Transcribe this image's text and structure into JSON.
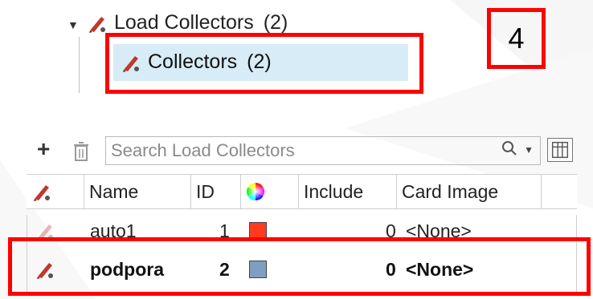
{
  "step_number": "4",
  "tree": {
    "parent": {
      "icon": "load-collector-icon",
      "label": "Load Collectors",
      "count": "(2)"
    },
    "child": {
      "icon": "load-collector-icon",
      "label": "Collectors",
      "count": "(2)"
    }
  },
  "toolbar": {
    "add_icon": "plus-icon",
    "delete_icon": "trash-icon",
    "search_placeholder": "Search Load Collectors",
    "search_icon": "magnifier-icon",
    "columns_icon": "column-chooser-icon"
  },
  "table": {
    "columns": [
      "Name",
      "ID",
      "Include",
      "Card Image"
    ],
    "color_column_icon": "color-wheel-icon",
    "rows": [
      {
        "name": "auto1",
        "id": "1",
        "color": "#ff3b1f",
        "include": "0",
        "card_image": "<None>",
        "selected": false
      },
      {
        "name": "podpora",
        "id": "2",
        "color": "#7f9ec4",
        "include": "0",
        "card_image": "<None>",
        "selected": true
      }
    ]
  },
  "colors": {
    "highlight": "#ff0000",
    "selection": "#d7ecf6"
  }
}
